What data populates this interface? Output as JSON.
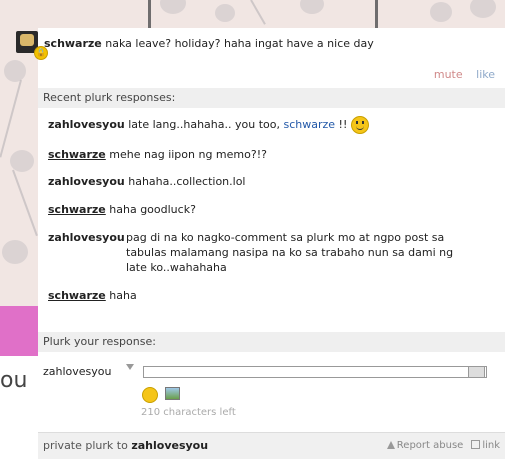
{
  "plurk": {
    "author": "schwarze",
    "text": "naka leave? holiday? haha ingat have a nice day",
    "mute_label": "mute",
    "like_label": "like"
  },
  "responses_header": "Recent plurk responses:",
  "responses": [
    {
      "user": "zahlovesyou",
      "text": "late lang..hahaha.. you too,",
      "mention": "schwarze",
      "suffix": "!!",
      "emoticon": "smiley-icon"
    },
    {
      "user": "schwarze",
      "text": "mehe nag iipon ng memo?!?"
    },
    {
      "user": "zahlovesyou",
      "text": "hahaha..collection.lol"
    },
    {
      "user": "schwarze",
      "text": "haha goodluck?"
    },
    {
      "user": "zahlovesyou",
      "text": "pag di na ko nagko-comment sa plurk mo at ngpo post sa tabulas malamang nasipa na ko sa trabaho nun sa dami ng late ko..wahahaha"
    },
    {
      "user": "schwarze",
      "text": "haha"
    }
  ],
  "reply": {
    "header": "Plurk your response:",
    "username": "zahlovesyou",
    "input_value": "",
    "chars_left": "210 characters left"
  },
  "footer": {
    "private_prefix": "private plurk to",
    "private_user": "zahlovesyou",
    "report": "Report abuse",
    "link": "link"
  },
  "background": {
    "partial_text": "ou"
  },
  "colors": {
    "mute": "#d08a8a",
    "like": "#8fa9c9",
    "mention": "#2258a8",
    "pink_block": "#e070c8"
  }
}
